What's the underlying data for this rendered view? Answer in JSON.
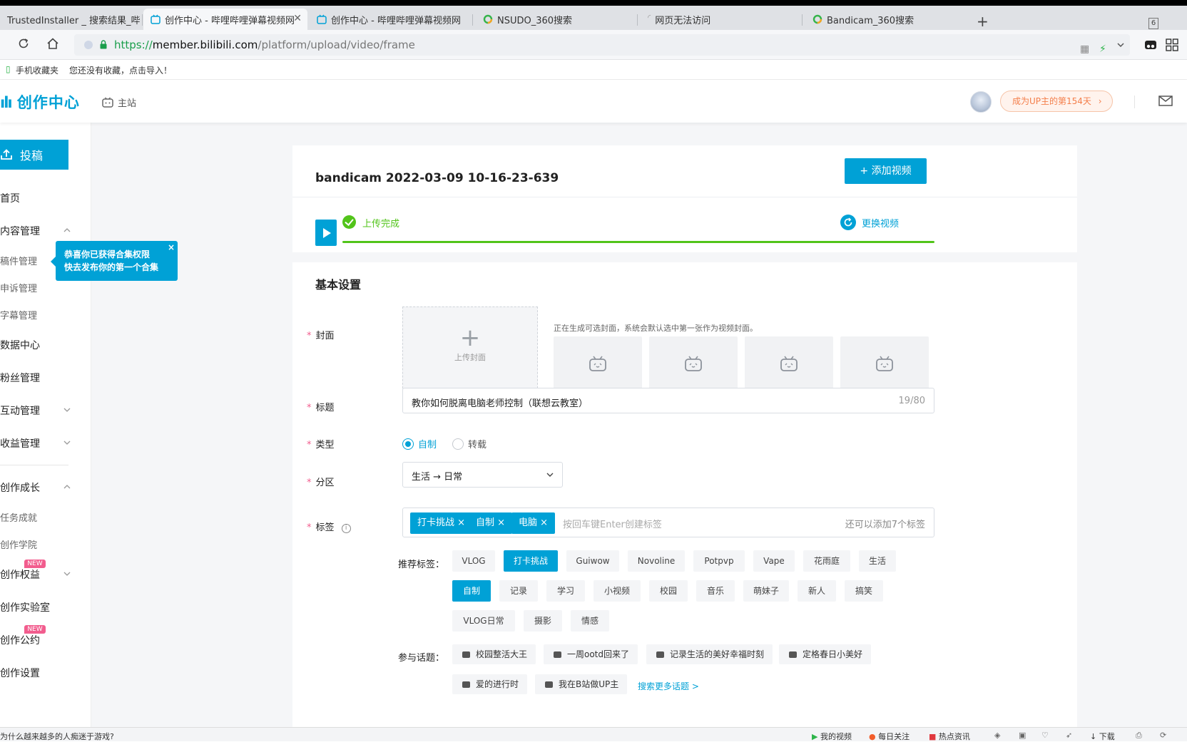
{
  "browser": {
    "tabs": [
      {
        "title": "TrustedInstaller _ 搜索结果_哔"
      },
      {
        "title": "创作中心 - 哔哩哔哩弹幕视频网"
      },
      {
        "title": "创作中心 - 哔哩哔哩弹幕视频网"
      },
      {
        "title": "NSUDO_360搜索"
      },
      {
        "title": "网页无法访问"
      },
      {
        "title": "Bandicam_360搜索"
      }
    ],
    "tab_count": "6",
    "url_scheme": "https://",
    "url_host": "member.bilibili.com",
    "url_path": "/platform/upload/video/frame",
    "bookmarks": [
      "手机收藏夹",
      "您还没有收藏，点击导入！"
    ]
  },
  "header": {
    "logo": "创作中心",
    "main_site": "主站",
    "up_badge": "成为UP主的第154天"
  },
  "sidebar": {
    "post_button": "投稿",
    "items": {
      "home": "首页",
      "content": "内容管理",
      "manuscripts": "稿件管理",
      "appeals": "申诉管理",
      "subtitles": "字幕管理",
      "data": "数据中心",
      "fans": "粉丝管理",
      "interaction": "互动管理",
      "income": "收益管理",
      "growth": "创作成长",
      "tasks": "任务成就",
      "academy": "创作学院",
      "rights": "创作权益",
      "lab": "创作实验室",
      "convention": "创作公约",
      "settings": "创作设置"
    },
    "new_badge": "NEW",
    "tooltip_line1": "恭喜你已获得合集权限",
    "tooltip_line2": "快去发布你的第一个合集",
    "tooltip_close": "×"
  },
  "upload": {
    "filename": "bandicam 2022-03-09 10-16-23-639",
    "add_video": "+ 添加视频",
    "status": "上传完成",
    "progress_percent": 100,
    "replace": "更换视频"
  },
  "basic": {
    "section_title": "基本设置",
    "cover_label": "封面",
    "cover_upload": "上传封面",
    "cover_tip": "正在生成可选封面，系统会默认选中第一张作为视频封面。",
    "title_label": "标题",
    "title_value": "教你如何脱离电脑老师控制（联想云教室）",
    "title_counter": "19/80",
    "type_label": "类型",
    "type_options": [
      "自制",
      "转载"
    ],
    "type_selected": "自制",
    "zone_label": "分区",
    "zone_value": "生活 → 日常",
    "tags_label": "标签",
    "tags": [
      "打卡挑战",
      "自制",
      "电脑"
    ],
    "tag_placeholder": "按回车键Enter创建标签",
    "tag_remaining": "还可以添加7个标签",
    "rec_label": "推荐标签：",
    "rec_tags": [
      "VLOG",
      "打卡挑战",
      "Guiwow",
      "Novoline",
      "Potpvp",
      "Vape",
      "花雨庭",
      "生活",
      "自制",
      "记录",
      "学习",
      "小视频",
      "校园",
      "音乐",
      "萌妹子",
      "新人",
      "搞笑",
      "VLOG日常",
      "摄影",
      "情感"
    ],
    "rec_selected": [
      "打卡挑战",
      "自制"
    ],
    "topic_label": "参与话题：",
    "topics": [
      "校园整活大王",
      "一周ootd回来了",
      "记录生活的美好幸福时刻",
      "定格春日小美好",
      "爱的进行时",
      "我在B站做UP主"
    ],
    "more_topics": "搜索更多话题 >"
  },
  "statusbar": {
    "left": "为什么越来越多的人痴迷于游戏?",
    "items": [
      "我的视频",
      "每日关注",
      "热点资讯",
      "下载"
    ]
  },
  "colors": {
    "accent": "#00a1d6",
    "success": "#52c41a",
    "badge": "#f25d8e"
  }
}
